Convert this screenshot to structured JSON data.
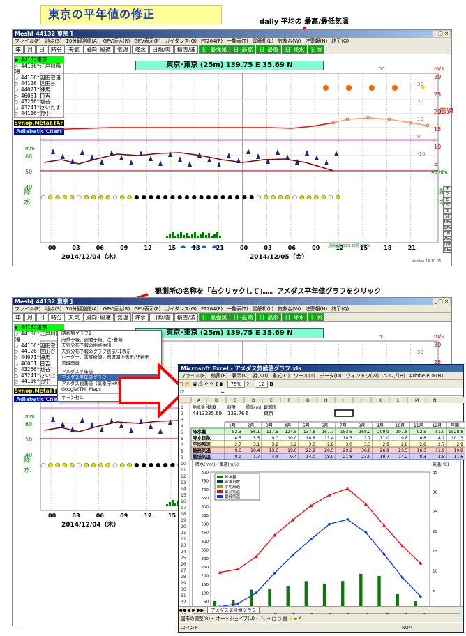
{
  "heading": "東京の平年値の修正",
  "annotations": {
    "top": "daily 平均の 最高/最低気温",
    "middle": "観測所の名称を「右クリックして」。。。アメダス平年値グラフをクリック"
  },
  "mesh": {
    "title": "Mesh[ 44132 東京 ]",
    "menu": [
      "ファイル(F)",
      "地点(S)",
      "10分観測値(A)",
      "GPV読込(R)",
      "GPV表示(P)",
      "ガイダンス(G)",
      "FT264(F)",
      "一覧表(T)",
      "雲解析(L)",
      "気象台(W)",
      "注警報(H)",
      "終了(Q)"
    ],
    "tabs": [
      "年",
      "月",
      "日",
      "時分",
      "天気",
      "風向･風速",
      "気温",
      "降水",
      "日照/雲",
      "積雪/波",
      "日･最強風",
      "日･最高",
      "日･最低",
      "日･降水",
      "日照"
    ],
    "stations": [
      "44132東京",
      "44136*江戸川臨海",
      "44166*羽田空港",
      "44126 世田谷",
      "44071*練馬",
      "46061 日吉",
      "43256*越谷",
      "43241*さいたま",
      "44116*府中",
      "46106横浜"
    ],
    "synop_button": "Synop,Metar,TAF",
    "adiabatic_button": "Adiabatic Chart",
    "station_bar": "東京･東京 (25m) 139.75 E  35.69 N",
    "wind_unit": "m/s",
    "temp_unit": "℃",
    "wind_axis_label": "風速",
    "precip_axis_label": "降水",
    "mm_label": "mm",
    "wind_ticks": [
      "30",
      "25",
      "20",
      "15",
      "10",
      "5"
    ],
    "temp_ticks": [
      "30",
      "20",
      "10",
      "0",
      "-10"
    ],
    "hpa_ticks": [
      "60",
      "50",
      "40"
    ],
    "hpa_right": "40 hPa",
    "hour_labels": [
      "00",
      "03",
      "06",
      "09",
      "12",
      "15",
      "18",
      "21",
      "00",
      "03",
      "06",
      "09",
      "12",
      "15",
      "18",
      "21"
    ],
    "date1": "2014/12/04（木）",
    "date2": "2014/12/05（金）",
    "right_side_buttons": [
      "T",
      "2",
      "E",
      "S",
      "3",
      "SL",
      "MFc",
      "GPV",
      "TM",
      "Wav",
      "Upp",
      "Obs"
    ],
    "version": "Version 14.10.06",
    "footer_note": "月間観測 51% 日照 153%"
  },
  "context_menu": {
    "items": [
      "時系列グラフ2",
      "府県予報、週間予報、注･警報",
      "天気分布予報の地点抽出",
      "天気分布予報のグラフ表示/非表示",
      "レーダー、雲解析値、概況図の表示/非表示",
      "流域雨量",
      "アメダス平年値",
      "アメダス平年値グラフ",
      "アメダス観測値（気象庁HP）",
      "Google(TM) Maps",
      "キャンセル"
    ],
    "highlight": 7
  },
  "excel": {
    "title": "Microsoft Excel - アメダス気候値グラフ.xls",
    "menu": [
      "ファイル(F)",
      "編集(E)",
      "表示(V)",
      "挿入(I)",
      "書式(O)",
      "ツール(T)",
      "データ(D)",
      "ウィンドウ(W)",
      "ヘルプ(H)",
      "Adobe PDF(B)"
    ],
    "zoom": "75%",
    "font_size": "12",
    "name_box": "I2",
    "formula": "=",
    "col_headers": [
      "A",
      "B",
      "C",
      "D",
      "E",
      "F",
      "G",
      "H",
      "I",
      "J",
      "K",
      "L",
      "M",
      "N"
    ],
    "info_headers": [
      "地点番号",
      "緯度",
      "経度",
      "標高(m)",
      "観測所"
    ],
    "info_values": [
      "44132",
      "35.69",
      "139.76",
      "6",
      "東京"
    ],
    "months": [
      "1月",
      "2月",
      "3月",
      "4月",
      "5月",
      "6月",
      "7月",
      "8月",
      "9月",
      "10月",
      "11月",
      "12月",
      "年間"
    ],
    "rows": [
      {
        "label": "降水量",
        "values": [
          "52.3",
          "56.1",
          "117.5",
          "124.5",
          "137.8",
          "167.7",
          "153.5",
          "168.2",
          "209.9",
          "197.8",
          "92.5",
          "51.0",
          "1528.8"
        ],
        "color": "#ccffcc"
      },
      {
        "label": "降水日数",
        "values": [
          "4.5",
          "5.5",
          "9.0",
          "10.0",
          "10.8",
          "11.4",
          "10.3",
          "7.7",
          "11.0",
          "9.8",
          "6.8",
          "4.2",
          "101.3"
        ],
        "color": "#ffffff"
      },
      {
        "label": "平均風速",
        "values": [
          "2.7",
          "3.1",
          "3.2",
          "3.2",
          "3.0",
          "2.8",
          "3.0",
          "3.3",
          "2.9",
          "2.8",
          "2.8",
          "2.7",
          "2.9"
        ],
        "color": "#ffffcc"
      },
      {
        "label": "最高気温",
        "values": [
          "9.6",
          "10.4",
          "13.6",
          "19.0",
          "22.9",
          "26.5",
          "29.2",
          "30.8",
          "26.9",
          "21.5",
          "16.3",
          "11.9",
          "19.8"
        ],
        "color": "#ffcccc"
      },
      {
        "label": "最低気温",
        "values": [
          "0.9",
          "1.7",
          "4.4",
          "9.4",
          "14.0",
          "18.0",
          "21.8",
          "23.0",
          "19.7",
          "14.2",
          "8.3",
          "3.5",
          "11.6"
        ],
        "color": "#ccccff"
      }
    ],
    "chart_left_label": "降水(mm)／風速(m/s)",
    "chart_right_label": "気温(℃)",
    "legend": [
      "降水量",
      "降水日数",
      "平均風速",
      "最高気温",
      "最低気温"
    ],
    "sheet_tab": "アメダス気候値グラフ",
    "draw_toolbar": "図形の調整(R)・  オートシェイプ(U)・",
    "status_left": "コマンド",
    "status_right": "NUM",
    "colors": {
      "precip": "#008000",
      "days": "#003399",
      "wind": "#999900",
      "tmax": "#ff0000",
      "tmin": "#0033ff"
    }
  },
  "chart_data": {
    "type": "bar",
    "categories": [
      "1月",
      "2月",
      "3月",
      "4月",
      "5月",
      "6月",
      "7月",
      "8月",
      "9月",
      "10月",
      "11月",
      "12月"
    ],
    "series": [
      {
        "name": "降水量",
        "type": "bar",
        "axis": "left",
        "values": [
          52.3,
          56.1,
          117.5,
          124.5,
          137.8,
          167.7,
          153.5,
          168.2,
          209.9,
          197.8,
          92.5,
          51.0
        ]
      },
      {
        "name": "降水日数",
        "type": "bar",
        "axis": "left",
        "values": [
          4.5,
          5.5,
          9.0,
          10.0,
          10.8,
          11.4,
          10.3,
          7.7,
          11.0,
          9.8,
          6.8,
          4.2
        ]
      },
      {
        "name": "平均風速",
        "type": "bar",
        "axis": "left",
        "values": [
          2.7,
          3.1,
          3.2,
          3.2,
          3.0,
          2.8,
          3.0,
          3.3,
          2.9,
          2.8,
          2.8,
          2.7
        ]
      },
      {
        "name": "最高気温",
        "type": "line",
        "axis": "right",
        "values": [
          9.6,
          10.4,
          13.6,
          19.0,
          22.9,
          26.5,
          29.2,
          30.8,
          26.9,
          21.5,
          16.3,
          11.9
        ]
      },
      {
        "name": "最低気温",
        "type": "line",
        "axis": "right",
        "values": [
          0.9,
          1.7,
          4.4,
          9.4,
          14.0,
          18.0,
          21.8,
          23.0,
          19.7,
          14.2,
          8.3,
          3.5
        ]
      }
    ],
    "left_ylim": [
      0,
      800
    ],
    "left_ticks": [
      "0",
      "50",
      "100",
      "150",
      "200",
      "250",
      "300",
      "350",
      "400",
      "450",
      "500",
      "550",
      "600",
      "650",
      "700",
      "750",
      "800"
    ],
    "right_ylim": [
      0,
      35
    ],
    "right_ticks": [
      "0",
      "5",
      "10",
      "15",
      "20",
      "25",
      "30",
      "35"
    ],
    "ylabel": "降水(mm)／風速(m/s)",
    "y2label": "気温(℃)",
    "legend_position": "top-left"
  }
}
